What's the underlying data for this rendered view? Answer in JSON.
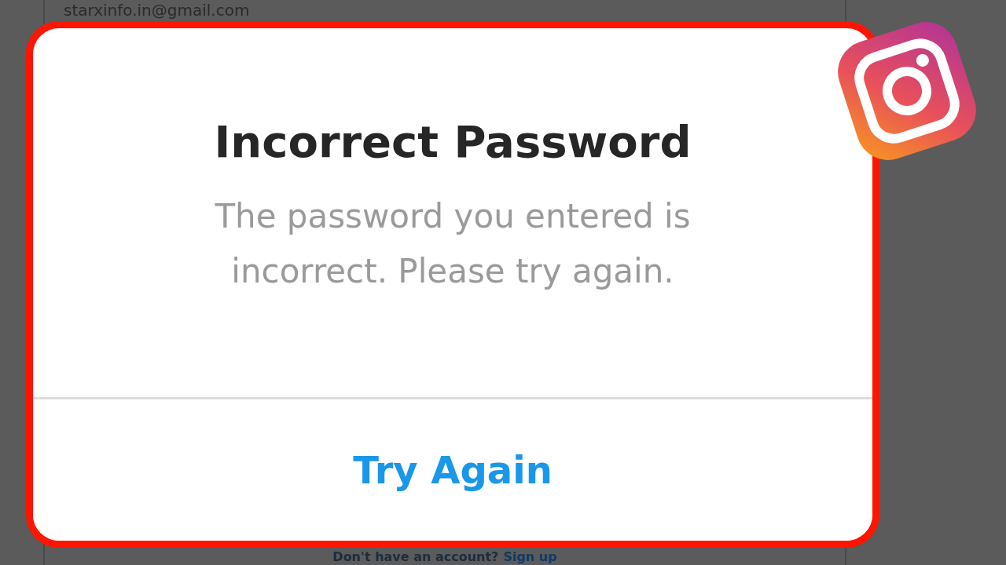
{
  "login_screen": {
    "email_value": "starxinfo.in@gmail.com",
    "signup_prompt": "Don't have an account?",
    "signup_link": "Sign up"
  },
  "dialog": {
    "title": "Incorrect Password",
    "message": "The password you entered is incorrect. Please try again.",
    "button": "Try Again"
  }
}
